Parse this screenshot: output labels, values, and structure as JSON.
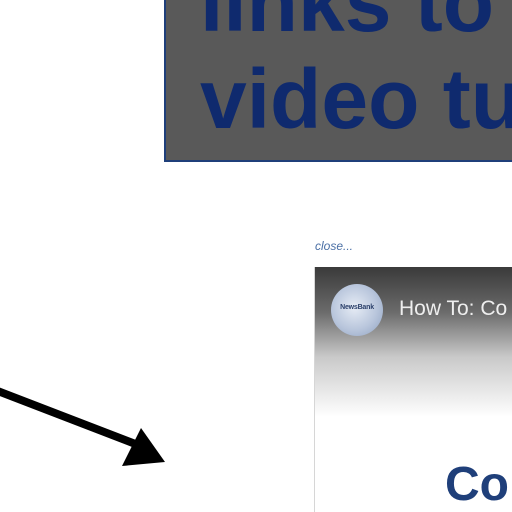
{
  "callout": {
    "line1": "links to",
    "line2": "video tu"
  },
  "close_link": {
    "label": "close..."
  },
  "video": {
    "channel_logo_text": "NewsBank",
    "title": "How To: Co",
    "frame_text": "Co"
  },
  "colors": {
    "callout_bg": "#595959",
    "callout_text": "#0f2a6e",
    "link": "#4a6fa5"
  },
  "icons": {
    "arrow": "arrow-icon"
  }
}
